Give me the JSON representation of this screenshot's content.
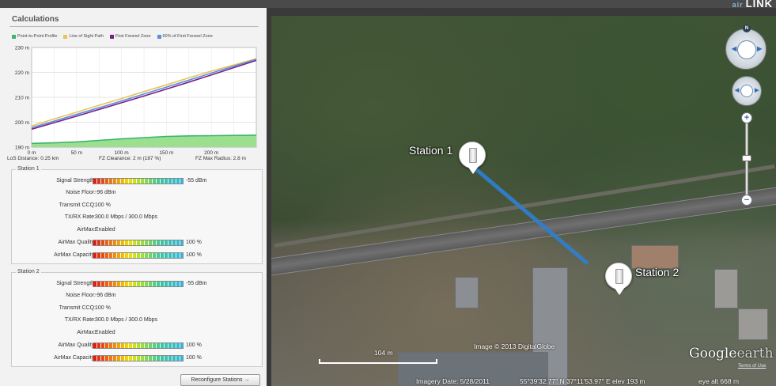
{
  "brand": {
    "sub": "air",
    "name": "LINK"
  },
  "calculations": {
    "title": "Calculations"
  },
  "legend": [
    {
      "label": "Point-to-Point Profile",
      "color": "#3cb371"
    },
    {
      "label": "Line of Sight Path",
      "color": "#e8c35a"
    },
    {
      "label": "First Fresnel Zone",
      "color": "#7a1f8a"
    },
    {
      "label": "60% of First Fresnel Zone",
      "color": "#5a8fd8"
    }
  ],
  "chart_data": {
    "type": "line",
    "title": "",
    "xlabel": "",
    "ylabel": "",
    "x_ticks": [
      "0 m",
      "50 m",
      "100 m",
      "150 m",
      "200 m"
    ],
    "y_ticks": [
      "190 m",
      "200 m",
      "210 m",
      "220 m",
      "230 m"
    ],
    "xlim": [
      0,
      250
    ],
    "ylim": [
      190,
      230
    ],
    "grid": true,
    "x": [
      0,
      25,
      50,
      75,
      100,
      125,
      150,
      175,
      200,
      225,
      250
    ],
    "series": [
      {
        "name": "Point-to-Point Profile",
        "type": "area",
        "color": "#3cb371",
        "values": [
          191.5,
          191.7,
          192.1,
          192.7,
          193.3,
          193.8,
          194.3,
          194.5,
          194.6,
          194.7,
          194.8
        ]
      },
      {
        "name": "Line of Sight Path",
        "color": "#e8c35a",
        "values": [
          198.5,
          201.3,
          204.0,
          206.8,
          209.5,
          212.3,
          215.0,
          217.8,
          220.5,
          223.0,
          225.5
        ]
      },
      {
        "name": "First Fresnel Zone",
        "color": "#7a1f8a",
        "values": [
          197.2,
          199.8,
          202.4,
          205.1,
          207.8,
          210.5,
          213.3,
          216.1,
          219.0,
          221.9,
          224.8
        ]
      },
      {
        "name": "60% of First Fresnel Zone",
        "color": "#5a8fd8",
        "values": [
          197.8,
          200.4,
          203.1,
          205.8,
          208.5,
          211.3,
          214.1,
          216.9,
          219.7,
          222.5,
          225.2
        ]
      }
    ]
  },
  "chart_meta": {
    "los_distance": "LoS Distance: 0.25 km",
    "fz_clearance": "FZ Clearance: 2 m  (187 %)",
    "fz_max_radius": "FZ Max Radius: 2.8 m"
  },
  "station1": {
    "legend": "Station 1",
    "signal_strength_label": "Signal Strength:",
    "signal_strength_value": "-55 dBm",
    "signal_strength_level": 1.0,
    "noise_floor_label": "Noise Floor:",
    "noise_floor_value": "-96 dBm",
    "transmit_ccq_label": "Transmit CCQ:",
    "transmit_ccq_value": "100 %",
    "txrx_rate_label": "TX/RX Rate:",
    "txrx_rate_value": "300.0 Mbps / 300.0 Mbps",
    "airmax_label": "AirMax:",
    "airmax_value": "Enabled",
    "airmax_quality_label": "AirMax Quality:",
    "airmax_quality_value": "100 %",
    "airmax_quality_level": 1.0,
    "airmax_capacity_label": "AirMax Capacity:",
    "airmax_capacity_value": "100 %",
    "airmax_capacity_level": 1.0
  },
  "station2": {
    "legend": "Station 2",
    "signal_strength_label": "Signal Strength:",
    "signal_strength_value": "-55 dBm",
    "signal_strength_level": 1.0,
    "noise_floor_label": "Noise Floor:",
    "noise_floor_value": "-96 dBm",
    "transmit_ccq_label": "Transmit CCQ:",
    "transmit_ccq_value": "100 %",
    "txrx_rate_label": "TX/RX Rate:",
    "txrx_rate_value": "300.0 Mbps / 300.0 Mbps",
    "airmax_label": "AirMax:",
    "airmax_value": "Enabled",
    "airmax_quality_label": "AirMax Quality:",
    "airmax_quality_value": "100 %",
    "airmax_quality_level": 1.0,
    "airmax_capacity_label": "AirMax Capacity:",
    "airmax_capacity_value": "100 %",
    "airmax_capacity_level": 1.0
  },
  "reconfigure_button": "Reconfigure Stations →",
  "map": {
    "station1_label": "Station 1",
    "station2_label": "Station 2",
    "compass_north": "N",
    "scale_label": "104 m",
    "imagery_credit": "Image © 2013 DigitalGlobe",
    "imagery_date": "Imagery Date: 5/28/2011",
    "coordinates": "55°39'32.77\" N  37°11'53.97\" E  elev  193 m",
    "eye_alt": "eye alt   668 m",
    "logo_google": "Google",
    "logo_earth": "earth",
    "terms": "Terms of Use",
    "link_color": "#2f7fd0"
  }
}
